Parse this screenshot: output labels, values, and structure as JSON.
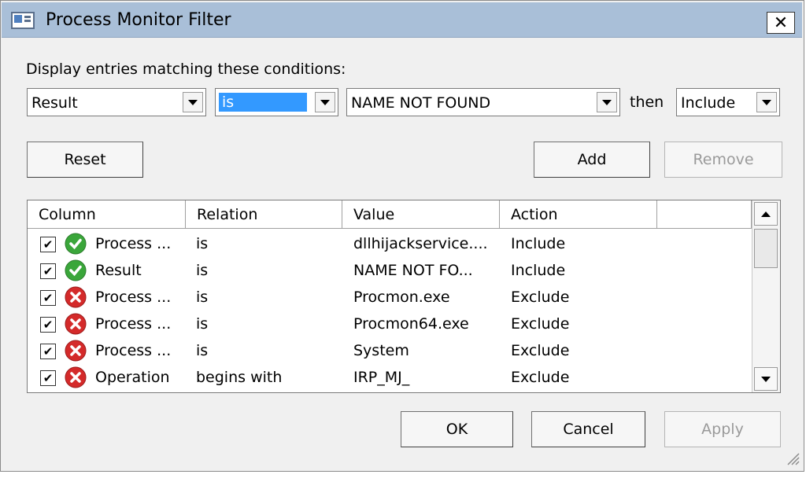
{
  "window": {
    "title": "Process Monitor Filter",
    "close_label": "✕"
  },
  "filter": {
    "prompt": "Display entries matching these conditions:",
    "column_value": "Result",
    "relation_value": "is",
    "value_value": "NAME NOT FOUND",
    "then_label": "then",
    "action_value": "Include"
  },
  "buttons": {
    "reset": "Reset",
    "add": "Add",
    "remove": "Remove",
    "ok": "OK",
    "cancel": "Cancel",
    "apply": "Apply"
  },
  "table": {
    "headers": [
      "Column",
      "Relation",
      "Value",
      "Action"
    ],
    "rows": [
      {
        "checked": true,
        "status": "include-icon",
        "column": "Process ...",
        "relation": "is",
        "value": "dllhijackservice....",
        "action": "Include"
      },
      {
        "checked": true,
        "status": "include-icon",
        "column": "Result",
        "relation": "is",
        "value": "NAME NOT FO...",
        "action": "Include"
      },
      {
        "checked": true,
        "status": "exclude-icon",
        "column": "Process ...",
        "relation": "is",
        "value": "Procmon.exe",
        "action": "Exclude"
      },
      {
        "checked": true,
        "status": "exclude-icon",
        "column": "Process ...",
        "relation": "is",
        "value": "Procmon64.exe",
        "action": "Exclude"
      },
      {
        "checked": true,
        "status": "exclude-icon",
        "column": "Process ...",
        "relation": "is",
        "value": "System",
        "action": "Exclude"
      },
      {
        "checked": true,
        "status": "exclude-icon",
        "column": "Operation",
        "relation": "begins with",
        "value": "IRP_MJ_",
        "action": "Exclude"
      }
    ]
  },
  "colors": {
    "titlebar": "#a9bfd8",
    "selection": "#3399ff",
    "include": "#3aa63a",
    "exclude": "#d42a2a"
  }
}
